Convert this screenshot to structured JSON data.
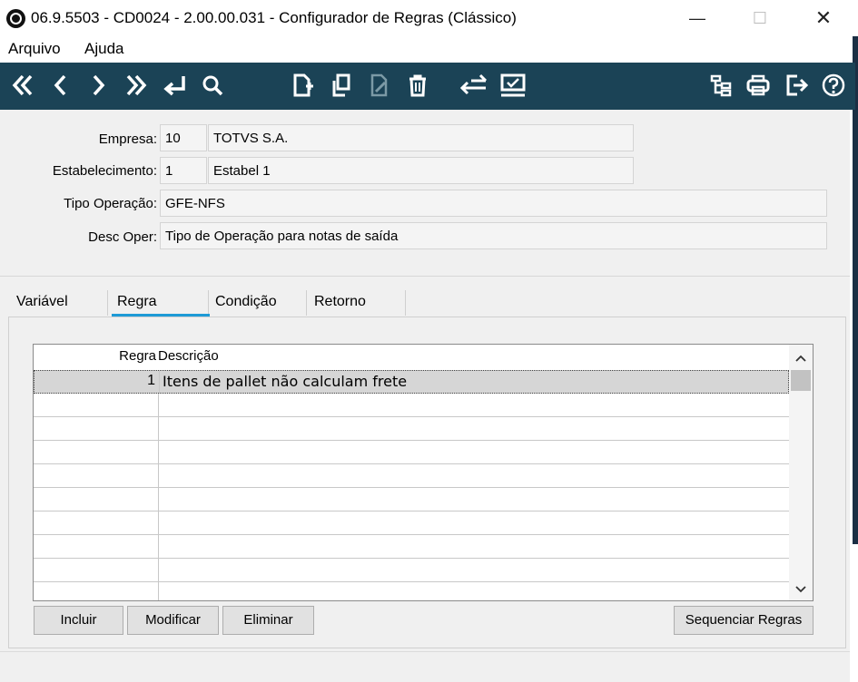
{
  "window": {
    "title": "06.9.5503 - CD0024 - 2.00.00.031 - Configurador de Regras (Clássico)",
    "minimize_glyph": "—",
    "maximize_glyph": "☐",
    "close_glyph": "✕"
  },
  "menu": {
    "items": [
      {
        "label": "Arquivo"
      },
      {
        "label": "Ajuda"
      }
    ]
  },
  "toolbar": {
    "icons": [
      "first-record-icon",
      "previous-record-icon",
      "next-record-icon",
      "last-record-icon",
      "goto-icon",
      "search-icon",
      "new-record-icon",
      "copy-record-icon",
      "edit-record-icon",
      "delete-record-icon",
      "switch-icon",
      "confirm-icon",
      "tree-icon",
      "print-icon",
      "exit-icon",
      "help-icon"
    ],
    "background": "#1b4356"
  },
  "form": {
    "empresa": {
      "label": "Empresa:",
      "code": "10",
      "name": "TOTVS S.A."
    },
    "estabelecimento": {
      "label": "Estabelecimento:",
      "code": "1",
      "name": "Estabel 1"
    },
    "tipo_operacao": {
      "label": "Tipo Operação:",
      "value": "GFE-NFS"
    },
    "desc_oper": {
      "label": "Desc Oper:",
      "value": "Tipo de Operação para notas de saída"
    }
  },
  "tabs": [
    {
      "label": "Variável",
      "active": false
    },
    {
      "label": "Regra",
      "active": true
    },
    {
      "label": "Condição",
      "active": false
    },
    {
      "label": "Retorno",
      "active": false
    }
  ],
  "accent_color": "#1e9ad6",
  "grid": {
    "columns": [
      "Regra",
      "Descrição"
    ],
    "rows": [
      {
        "regra": "1",
        "descricao": "Itens de pallet não calculam frete"
      }
    ]
  },
  "buttons": {
    "incluir": "Incluir",
    "modificar": "Modificar",
    "eliminar": "Eliminar",
    "sequenciar": "Sequenciar Regras"
  }
}
